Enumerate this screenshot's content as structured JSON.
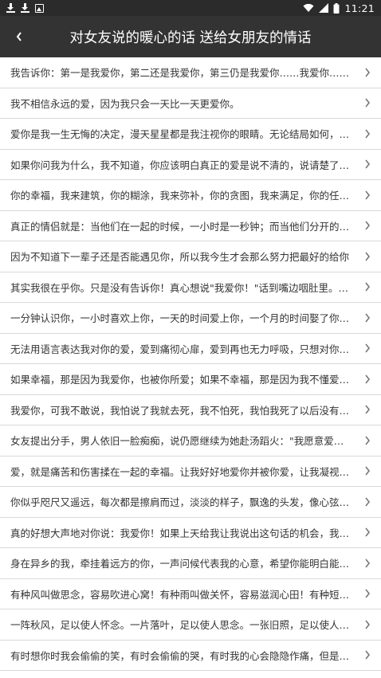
{
  "status_bar": {
    "time": "11:21",
    "left_icons": [
      "download-icon",
      "download-icon",
      "photo-icon"
    ],
    "right_icons": [
      "wifi-icon",
      "signal-icon",
      "battery-icon"
    ]
  },
  "header": {
    "title": "对女友说的暖心的话 送给女朋友的情话",
    "back_icon": "chevron-left-icon",
    "background": "#333333"
  },
  "list": {
    "items": [
      {
        "text": "我告诉你：第一是我爱你，第二还是我爱你，第三仍是我爱你……我爱你……"
      },
      {
        "text": "我不相信永远的爱，因为我只会一天比一天更爱你。"
      },
      {
        "text": "爱你是我一生无悔的决定，漫天星星都是我注视你的眼睛。无论结局如何，我都会爱你"
      },
      {
        "text": "如果你问我为什么，我不知道，你应该明白真正的爱是说不清的，说请楚了就不是爱了"
      },
      {
        "text": "你的幸福，我来建筑，你的糊涂，我来弥补，你的贪图，我来满足，你的任性，我来包容"
      },
      {
        "text": "真正的情侣就是：当他们在一起的时候，一小时是一秒钟；而当他们分开的时候，一秒钟是一小时"
      },
      {
        "text": "因为不知道下一辈子还是否能遇见你，所以我今生才会那么努力把最好的给你"
      },
      {
        "text": "其实我很在乎你。只是没有告诉你！真心想说\"我爱你！\"话到嘴边咽肚里。没勇气说出口"
      },
      {
        "text": "一分钟认识你，一小时喜欢上你，一天的时间爱上你，一个月的时间娶了你，一辈子的时间来爱你"
      },
      {
        "text": "无法用语言表达我对你的爱，爱到痛彻心扉，爱到再也无力呼吸，只想对你说一声我爱你"
      },
      {
        "text": "如果幸福，那是因为我爱你，也被你所爱；如果不幸福，那是因为我不懂爱自己"
      },
      {
        "text": "我爱你，可我不敢说，我怕说了我就去死，我不怕死，我怕我死了以后没有人像我这样爱你"
      },
      {
        "text": "女友提出分手，男人依旧一脸痴痴，说仍愿继续为她赴汤蹈火：\"我愿意爱你、照顾你一辈子\""
      },
      {
        "text": "爱，就是痛苦和伤害揉在一起的幸福。让我好好地爱你并被你爱，让我凝视你的眼睛"
      },
      {
        "text": "你似乎咫尺又遥远，每次都是擦肩而过，淡淡的样子，飘逸的头发，像心弦地轻轻拨动"
      },
      {
        "text": "真的好想大声地对你说：我爱你！如果上天给我让我说出这句话的机会，我会说我爱你一万年"
      },
      {
        "text": "身在异乡的我，牵挂着远方的你，一声问候代表我的心意，希望你能明白能够感受我的爱"
      },
      {
        "text": "有种风叫做思念，容易吹进心窝！有种雨叫做关怀，容易滋润心田！有种短信叫做想你"
      },
      {
        "text": "一阵秋风，足以使人怀念。一片落叶，足以使人思念。一张旧照，足以使人留恋一生"
      },
      {
        "text": "有时想你时我会偷偷的笑，有时会偷偷的哭，有时我的心会隐隐作痛，但是每次我都很幸福"
      }
    ],
    "chevron_icon": "chevron-right-icon"
  }
}
